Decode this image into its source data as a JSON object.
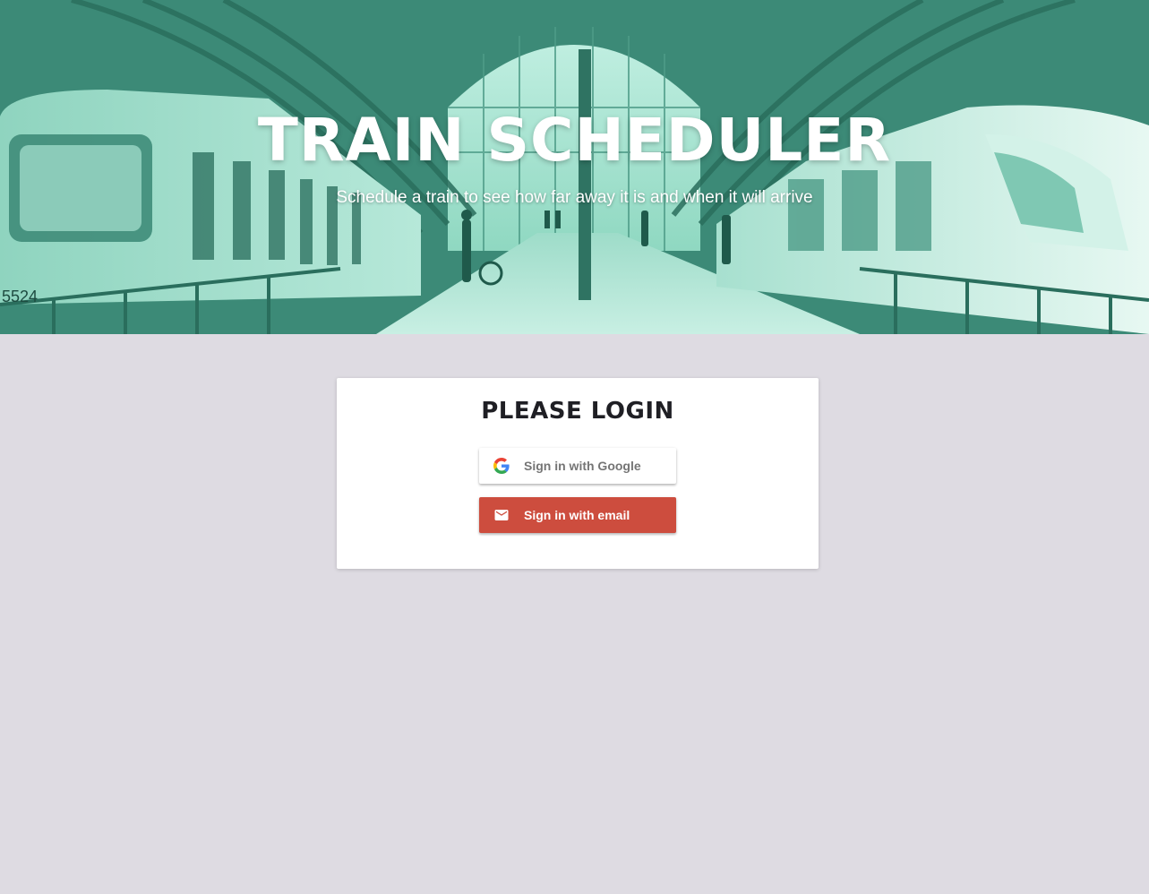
{
  "hero": {
    "title": "TRAIN SCHEDULER",
    "subtitle": "Schedule a train to see how far away it is and when it will arrive",
    "train_number": "5524",
    "tint_color": "#5cbfa3"
  },
  "login": {
    "title": "PLEASE LOGIN",
    "google_button": {
      "label": "Sign in with Google",
      "icon": "google-logo-icon",
      "background": "#ffffff",
      "text_color": "#757575"
    },
    "email_button": {
      "label": "Sign in with email",
      "icon": "mail-icon",
      "background": "#cd4d3e",
      "text_color": "#ffffff"
    }
  },
  "page": {
    "background": "#dedbe2"
  }
}
